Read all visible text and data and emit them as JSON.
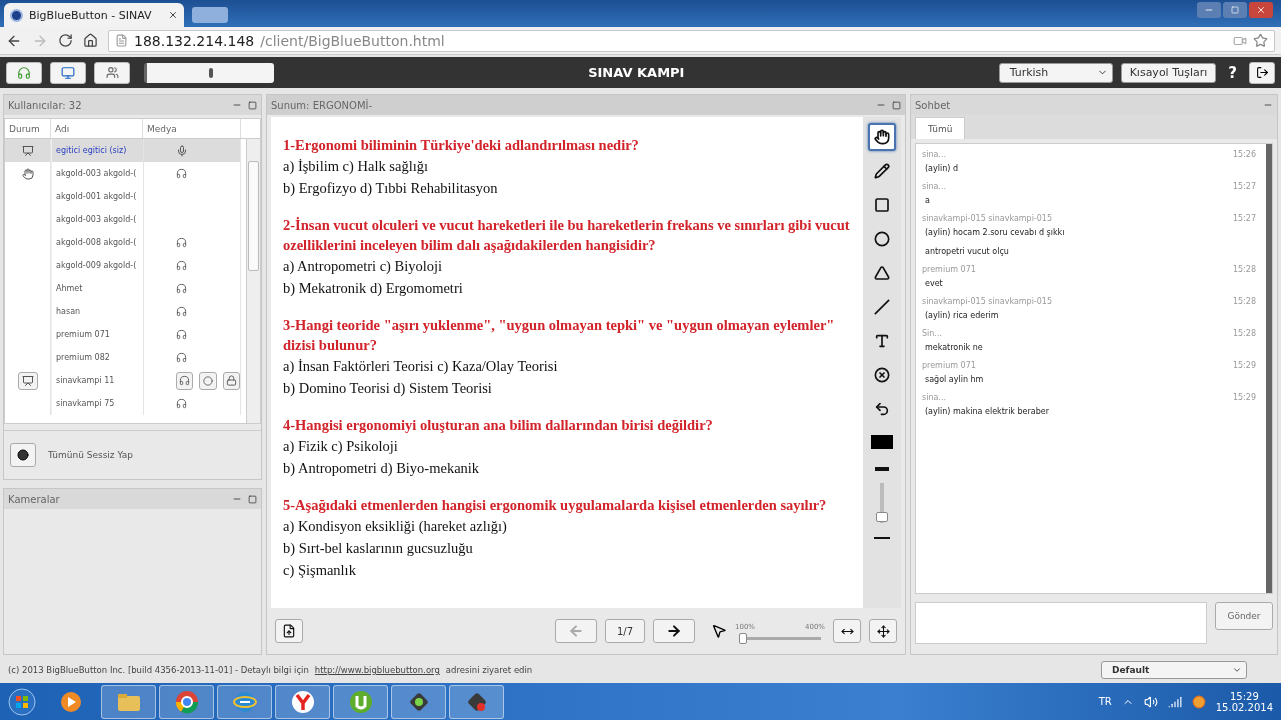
{
  "browser": {
    "tab_title": "BigBlueButton - SINAV",
    "url_host": "188.132.214.148",
    "url_path": "/client/BigBlueButton.html"
  },
  "toolbar": {
    "mic": {
      "level": 0.5
    },
    "title": "SINAV KAMPI",
    "language": "Turkish",
    "shortcuts": "Kısayol Tuşları",
    "help": "?"
  },
  "users": {
    "title": "Kullanıcılar: 32",
    "columns": [
      "Durum",
      "Adı",
      "Medya"
    ],
    "rows": [
      {
        "name": "egitici egitici (siz)",
        "presenter": true,
        "hand_raised": false,
        "microphone": true,
        "listening": false,
        "selected": true,
        "is_self": true,
        "controls": false
      },
      {
        "name": "akgold-003 akgold-(",
        "presenter": false,
        "hand_raised": true,
        "microphone": false,
        "listening": true,
        "selected": false,
        "is_self": false,
        "controls": false
      },
      {
        "name": "akgold-001 akgold-(",
        "presenter": false,
        "hand_raised": false,
        "microphone": false,
        "listening": false,
        "selected": false,
        "is_self": false,
        "controls": false
      },
      {
        "name": "akgold-003 akgold-(",
        "presenter": false,
        "hand_raised": false,
        "microphone": false,
        "listening": false,
        "selected": false,
        "is_self": false,
        "controls": false
      },
      {
        "name": "akgold-008 akgold-(",
        "presenter": false,
        "hand_raised": false,
        "microphone": false,
        "listening": true,
        "selected": false,
        "is_self": false,
        "controls": false
      },
      {
        "name": "akgold-009 akgold-(",
        "presenter": false,
        "hand_raised": false,
        "microphone": false,
        "listening": true,
        "selected": false,
        "is_self": false,
        "controls": false
      },
      {
        "name": "Ahmet",
        "presenter": false,
        "hand_raised": false,
        "microphone": false,
        "listening": true,
        "selected": false,
        "is_self": false,
        "controls": false
      },
      {
        "name": "hasan",
        "presenter": false,
        "hand_raised": false,
        "microphone": false,
        "listening": true,
        "selected": false,
        "is_self": false,
        "controls": false
      },
      {
        "name": "premium 071",
        "presenter": false,
        "hand_raised": false,
        "microphone": false,
        "listening": true,
        "selected": false,
        "is_self": false,
        "controls": false
      },
      {
        "name": "premium 082",
        "presenter": false,
        "hand_raised": false,
        "microphone": false,
        "listening": true,
        "selected": false,
        "is_self": false,
        "controls": false
      },
      {
        "name": "sinavkampi 11",
        "presenter": false,
        "hand_raised": false,
        "microphone": false,
        "listening": true,
        "selected": false,
        "is_self": false,
        "controls": true
      },
      {
        "name": "sinavkampi 75",
        "presenter": false,
        "hand_raised": false,
        "microphone": false,
        "listening": true,
        "selected": false,
        "is_self": false,
        "controls": false
      }
    ],
    "mute_all": "Tümünü Sessiz Yap"
  },
  "cameras": {
    "title": "Kameralar"
  },
  "presentation": {
    "title": "Sunum: ERGONOMİ-",
    "questions": [
      {
        "question": "1-Ergonomi biliminin Türkiye'deki adlandırılması nedir?",
        "answers": [
          "a) İşbilim c) Halk sağlığı",
          "b) Ergofizyo d) Tıbbi Rehabilitasyon"
        ]
      },
      {
        "question": "2-İnsan vucut olculeri ve vucut hareketleri ile bu hareketlerin frekans ve sınırları gibi vucut ozelliklerini inceleyen bilim dalı aşağıdakilerden hangisidir?",
        "answers": [
          "a) Antropometri c) Biyoloji",
          "b) Mekatronik d) Ergomometri"
        ]
      },
      {
        "question": "3-Hangi teoride \"aşırı yuklenme\", \"uygun olmayan tepki\" ve \"uygun olmayan eylemler\" dizisi bulunur?",
        "answers": [
          "a) İnsan Faktörleri Teorisi c) Kaza/Olay Teorisi",
          "b) Domino Teorisi d) Sistem Teorisi"
        ]
      },
      {
        "question": "4-Hangisi ergonomiyi oluşturan ana bilim dallarından birisi değildir?",
        "answers": [
          "a) Fizik c) Psikoloji",
          "b) Antropometri d) Biyo-mekanik"
        ]
      },
      {
        "question": "5-Aşağıdaki etmenlerden hangisi ergonomik uygulamalarda kişisel etmenlerden sayılır?",
        "answers": [
          "a) Kondisyon eksikliği (hareket azlığı)",
          "b) Sırt-bel kaslarının gucsuzluğu",
          "c) Şişmanlık"
        ]
      }
    ],
    "tools": [
      {
        "kind": "hand",
        "selected": true
      },
      {
        "kind": "pencil",
        "selected": false
      },
      {
        "kind": "rectangle",
        "selected": false
      },
      {
        "kind": "ellipse",
        "selected": false
      },
      {
        "kind": "triangle",
        "selected": false
      },
      {
        "kind": "line",
        "selected": false
      },
      {
        "kind": "text",
        "selected": false
      },
      {
        "kind": "clear",
        "selected": false
      },
      {
        "kind": "undo",
        "selected": false
      }
    ],
    "thickness": {
      "level": 0.15
    },
    "page": "1/7",
    "zoom": {
      "min": "100%",
      "max": "400%",
      "level": 0.05
    }
  },
  "chat": {
    "title": "Sohbet",
    "tabs": [
      {
        "label": "Tümü",
        "selected": true
      }
    ],
    "messages": [
      {
        "sender": "sina...",
        "time": "15:26",
        "lines": [
          "(aylin) d"
        ]
      },
      {
        "sender": "sina...",
        "time": "15:27",
        "lines": [
          "a"
        ]
      },
      {
        "sender": "sinavkampi-015 sinavkampi-015",
        "time": "15:27",
        "lines": [
          "(aylin) hocam 2.soru cevabı d şıkkı",
          "antropetri vucut olçu"
        ]
      },
      {
        "sender": "premium 071",
        "time": "15:28",
        "lines": [
          "evet"
        ]
      },
      {
        "sender": "sinavkampi-015 sinavkampi-015",
        "time": "15:28",
        "lines": [
          "(aylin) rica ederim"
        ]
      },
      {
        "sender": "Sin...",
        "time": "15:28",
        "lines": [
          "mekatronik ne"
        ]
      },
      {
        "sender": "premium 071",
        "time": "15:29",
        "lines": [
          "sağol aylin hm"
        ]
      },
      {
        "sender": "sina...",
        "time": "15:29",
        "lines": [
          "(aylin) makina elektrik beraber"
        ]
      }
    ],
    "send": "Gönder"
  },
  "footer": {
    "text": "(c) 2013 BigBlueButton Inc. [build 4356-2013-11-01] - Detaylı bilgi için",
    "link": "http://www.bigbluebutton.org",
    "tail": "adresini ziyaret edin",
    "layout": "Default"
  },
  "taskbar": {
    "language": "TR",
    "time": "15:29",
    "date": "15.02.2014"
  }
}
